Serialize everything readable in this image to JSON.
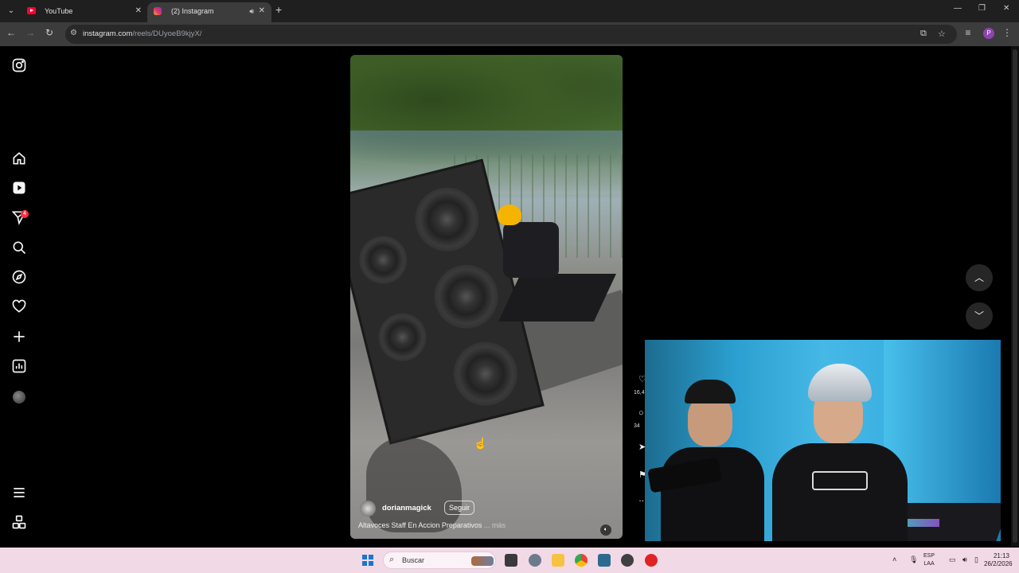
{
  "browser": {
    "tabs": [
      {
        "title": "YouTube",
        "favicon": "youtube-icon"
      },
      {
        "title": "(2) Instagram",
        "favicon": "instagram-icon",
        "audio": true,
        "active": true
      }
    ],
    "url_host": "instagram.com",
    "url_path": "/reels/DUyoeB9kjyX/",
    "profile_initial": "P"
  },
  "sidebar": {
    "items": [
      "instagram-logo-icon",
      "home-icon",
      "reels-icon",
      "messages-icon",
      "search-icon",
      "explore-icon",
      "notifications-icon",
      "create-icon",
      "dashboard-icon",
      "profile-avatar",
      "more-menu-icon",
      "meta-apps-icon"
    ],
    "messages_badge": "4"
  },
  "reel": {
    "username": "dorianmagick",
    "follow_label": "Seguir",
    "caption": "Altavoces Staff En Accion Preparativos",
    "caption_more": "... más"
  },
  "actions": {
    "likes_partial": "16,4",
    "comments_partial": "34"
  },
  "taskbar": {
    "search_label": "Buscar",
    "lang_line1": "ESP",
    "lang_line2": "LAA",
    "time": "21:13",
    "date": "26/2/2026"
  },
  "colors": {
    "tab_active": "#3c3c3c",
    "tabstrip": "#1f1f1f",
    "taskbar": "#f2d9e6",
    "badge": "#ff3040"
  }
}
